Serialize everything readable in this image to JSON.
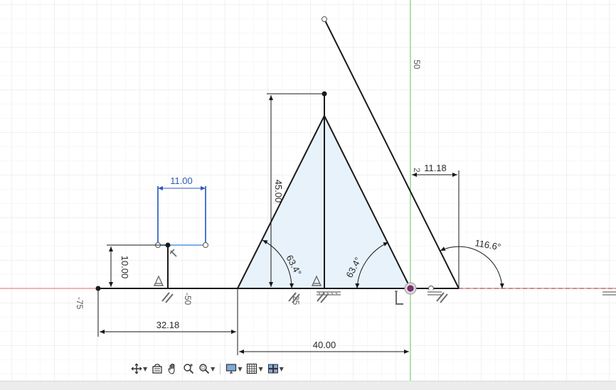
{
  "dimensions": {
    "width_11": "11.00",
    "height_10": "10.00",
    "height_45": "45.00",
    "width_1118": "11.18",
    "offset_3218": "32.18",
    "base_40": "40.00",
    "angle_left": "63.4°",
    "angle_right": "63.4°",
    "angle_obtuse": "116.6°",
    "small_mark": "2"
  },
  "axis_labels": {
    "x_minus_75": "-75",
    "x_minus_50": "-50",
    "x_minus_25": "-25",
    "y_50": "50"
  },
  "toolbar": {
    "items": [
      {
        "name": "orbit-icon",
        "has_caret": true
      },
      {
        "name": "look-at-icon",
        "has_caret": false
      },
      {
        "name": "pan-icon",
        "has_caret": false
      },
      {
        "name": "zoom-icon",
        "has_caret": false
      },
      {
        "name": "zoom-window-icon",
        "has_caret": true
      },
      {
        "name": "display-settings-icon",
        "has_caret": true
      },
      {
        "name": "grid-settings-icon",
        "has_caret": true
      },
      {
        "name": "viewports-icon",
        "has_caret": true
      }
    ]
  },
  "colors": {
    "grid_minor": "#f0f0f0",
    "grid_major": "#dedede",
    "x_axis": "#e05050",
    "y_axis": "#5cc15c",
    "sketch_line": "#1a1a1a",
    "profile_fill": "#e6f1fb",
    "selected_dim": "#2f5bb7",
    "constraint_icon": "#6a6a6a"
  }
}
